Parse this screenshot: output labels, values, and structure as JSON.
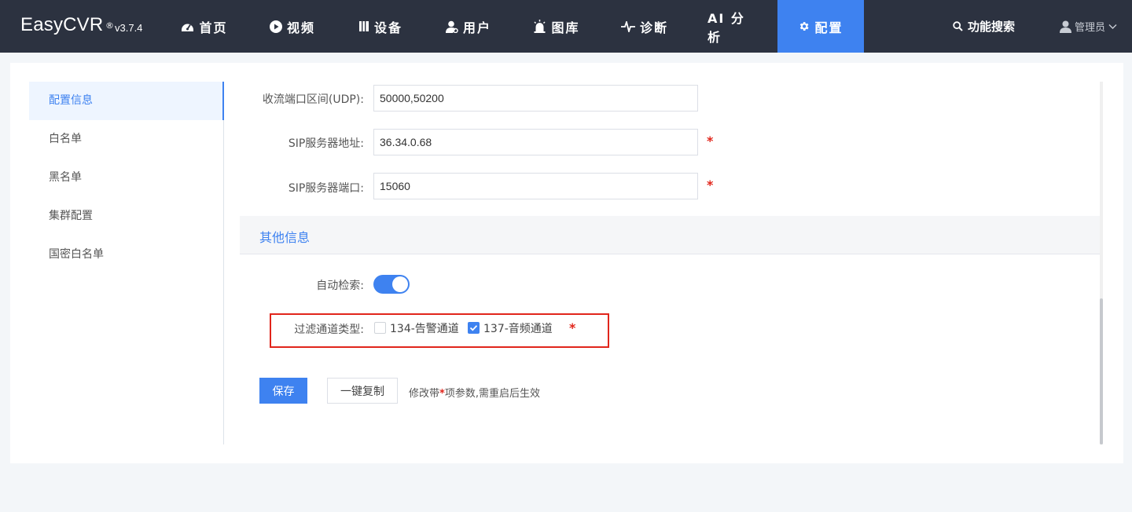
{
  "brand": {
    "name": "EasyCVR",
    "reg": "®",
    "version": "v3.7.4"
  },
  "nav": {
    "items": [
      {
        "label": "首页",
        "icon": "dashboard-icon"
      },
      {
        "label": "视频",
        "icon": "play-icon"
      },
      {
        "label": "设备",
        "icon": "device-icon"
      },
      {
        "label": "用户",
        "icon": "user-icon"
      },
      {
        "label": "图库",
        "icon": "alarm-icon"
      },
      {
        "label": "诊断",
        "icon": "pulse-icon"
      },
      {
        "label": "AI 分析",
        "icon": ""
      },
      {
        "label": "配置",
        "icon": "gear-icon",
        "active": true
      }
    ],
    "search_label": "功能搜索",
    "user_label": "管理员"
  },
  "sidebar": {
    "items": [
      {
        "label": "配置信息",
        "active": true
      },
      {
        "label": "白名单"
      },
      {
        "label": "黑名单"
      },
      {
        "label": "集群配置"
      },
      {
        "label": "国密白名单"
      }
    ]
  },
  "form": {
    "udp_range": {
      "label": "收流端口区间(UDP):",
      "value": "50000,50200"
    },
    "sip_address": {
      "label": "SIP服务器地址:",
      "value": "36.34.0.68",
      "required": "*"
    },
    "sip_port": {
      "label": "SIP服务器端口:",
      "value": "15060",
      "required": "*"
    }
  },
  "other_section": {
    "title": "其他信息",
    "auto_search": {
      "label": "自动检索:",
      "enabled": true
    },
    "filter_channel": {
      "label": "过滤通道类型:",
      "options": [
        {
          "label": "134-告警通道",
          "checked": false
        },
        {
          "label": "137-音频通道",
          "checked": true
        }
      ],
      "required": "*"
    }
  },
  "actions": {
    "save_label": "保存",
    "copy_label": "一键复制",
    "hint_before": "修改带",
    "hint_star": "*",
    "hint_after": "项参数,需重启后生效"
  },
  "colors": {
    "nav_bg": "#2c3240",
    "accent": "#3e82f0",
    "required": "#e1251b"
  }
}
